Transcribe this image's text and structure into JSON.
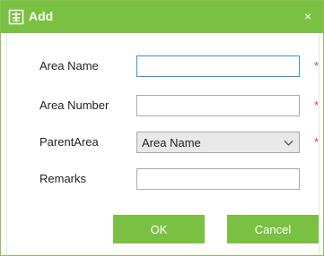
{
  "dialog": {
    "title": "Add",
    "close_symbol": "×",
    "icons": {
      "title": "add-area-icon",
      "close": "close-icon"
    }
  },
  "form": {
    "area_name": {
      "label": "Area Name",
      "value": "",
      "required_mark": "*"
    },
    "area_number": {
      "label": "Area Number",
      "value": "",
      "required_mark": "*"
    },
    "parent_area": {
      "label": "ParentArea",
      "selected": "Area Name",
      "required_mark": "*"
    },
    "remarks": {
      "label": "Remarks",
      "value": ""
    }
  },
  "buttons": {
    "ok": "OK",
    "cancel": "Cancel"
  },
  "colors": {
    "accent": "#7ac143",
    "required": "#e03c3c",
    "focus_border": "#3c8fd9"
  }
}
